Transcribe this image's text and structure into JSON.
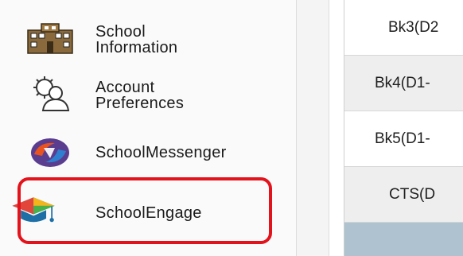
{
  "sidebar": {
    "items": [
      {
        "label_lines": [
          "School",
          "Information"
        ],
        "icon": "school-building-icon"
      },
      {
        "label_lines": [
          "Account",
          "Preferences"
        ],
        "icon": "account-gear-person-icon"
      },
      {
        "label": "SchoolMessenger",
        "icon": "schoolmessenger-logo-icon"
      },
      {
        "label": "SchoolEngage",
        "icon": "graduation-cap-icon"
      }
    ],
    "highlight_color": "#e3121b"
  },
  "table": {
    "rows": [
      {
        "text": "Bk3(D2"
      },
      {
        "text": "Bk4(D1-"
      },
      {
        "text": "Bk5(D1-"
      },
      {
        "text": "CTS(D"
      },
      {
        "text": ""
      }
    ],
    "colors": {
      "row_white": "#ffffff",
      "row_gray": "#eeeeee",
      "row_selected": "#aec2cf"
    }
  }
}
